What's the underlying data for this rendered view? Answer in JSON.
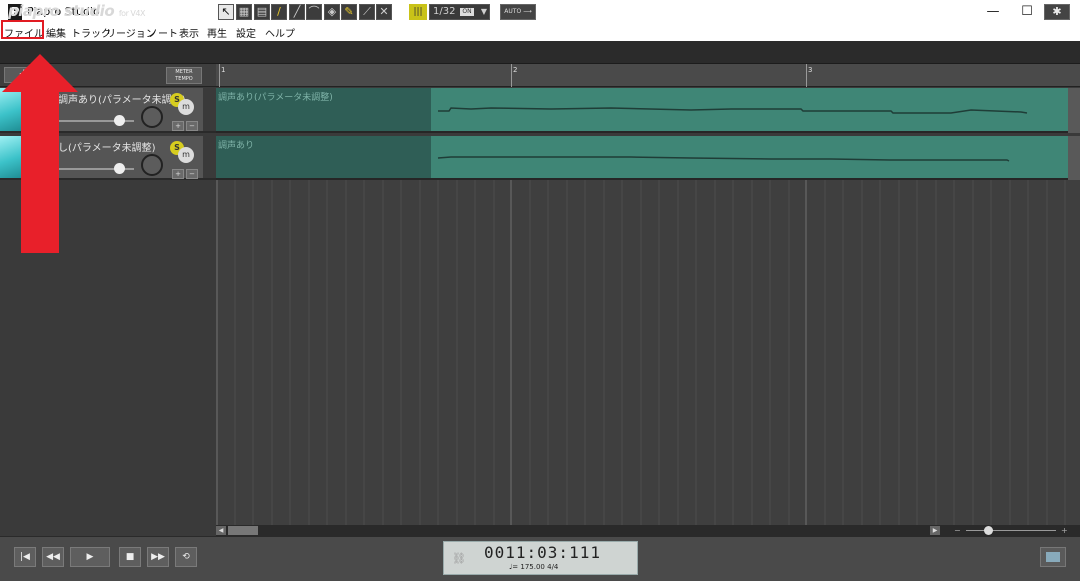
{
  "window": {
    "title": "Piapro Studio",
    "app_icon_letter": "P",
    "minimize": "—",
    "maximize": "☐",
    "close": "✕"
  },
  "menu": [
    {
      "name": "menu-file",
      "label": "ファイル"
    },
    {
      "name": "menu-edit",
      "label": "編集"
    },
    {
      "name": "menu-track",
      "label": "トラック"
    },
    {
      "name": "menu-region",
      "label": "リージョン"
    },
    {
      "name": "menu-note",
      "label": "ノート"
    },
    {
      "name": "menu-view",
      "label": "表示"
    },
    {
      "name": "menu-play",
      "label": "再生"
    },
    {
      "name": "menu-settings",
      "label": "設定"
    },
    {
      "name": "menu-help",
      "label": "ヘルプ"
    }
  ],
  "toolbar": {
    "logo": "piapro studio",
    "logo_suffix": "for V4X",
    "tools": [
      {
        "name": "pointer-tool-icon",
        "glyph": "↖"
      },
      {
        "name": "select-tool-icon",
        "glyph": "▦"
      },
      {
        "name": "range-tool-icon",
        "glyph": "▤"
      },
      {
        "name": "pencil-tool-icon",
        "glyph": "/"
      },
      {
        "name": "line-tool-icon",
        "glyph": "╱"
      },
      {
        "name": "curve-tool-icon",
        "glyph": "⌒"
      },
      {
        "name": "eraser-tool-icon",
        "glyph": "◈"
      },
      {
        "name": "brush-tool-icon",
        "glyph": "✎"
      },
      {
        "name": "knife-tool-icon",
        "glyph": "⟋"
      },
      {
        "name": "delete-tool-icon",
        "glyph": "✕"
      }
    ],
    "quantize": "1/32",
    "quantize_badge": "ON",
    "auto_button": "AUTO ⟶",
    "settings_glyph": "✱"
  },
  "track_header": {
    "add_button": "+",
    "meter_tempo": [
      "METER",
      "TEMPO"
    ]
  },
  "tracks": [
    {
      "name": "調声あり(パラメータ未調整)",
      "solo": "S",
      "mute": "m",
      "volume": 0.8,
      "region_label": "調声あり(パラメータ未調整)"
    },
    {
      "name": "調声なし(パラメータ未調整)",
      "display_name": "し(パラメータ未調整)",
      "solo": "S",
      "mute": "m",
      "volume": 0.8,
      "region_label": "調声あり"
    }
  ],
  "ruler": {
    "marks": [
      "1",
      "2",
      "3"
    ]
  },
  "transport": {
    "buttons": [
      {
        "name": "go-to-start-button",
        "glyph": "|◀"
      },
      {
        "name": "rewind-button",
        "glyph": "◀◀"
      },
      {
        "name": "play-button",
        "glyph": "▶"
      },
      {
        "name": "stop-button",
        "glyph": "■"
      },
      {
        "name": "fast-forward-button",
        "glyph": "▶▶"
      },
      {
        "name": "loop-button",
        "glyph": "⟲"
      }
    ],
    "time": "0011:03:111",
    "tempo": "♩= 175.00   4/4"
  },
  "annotation": {
    "highlight_color": "#e11b22",
    "arrow_color": "#e8202a"
  },
  "colors": {
    "region_dark": "#2f5e56",
    "region_light": "#3f8676",
    "solo_yellow": "#d7cd1f"
  }
}
